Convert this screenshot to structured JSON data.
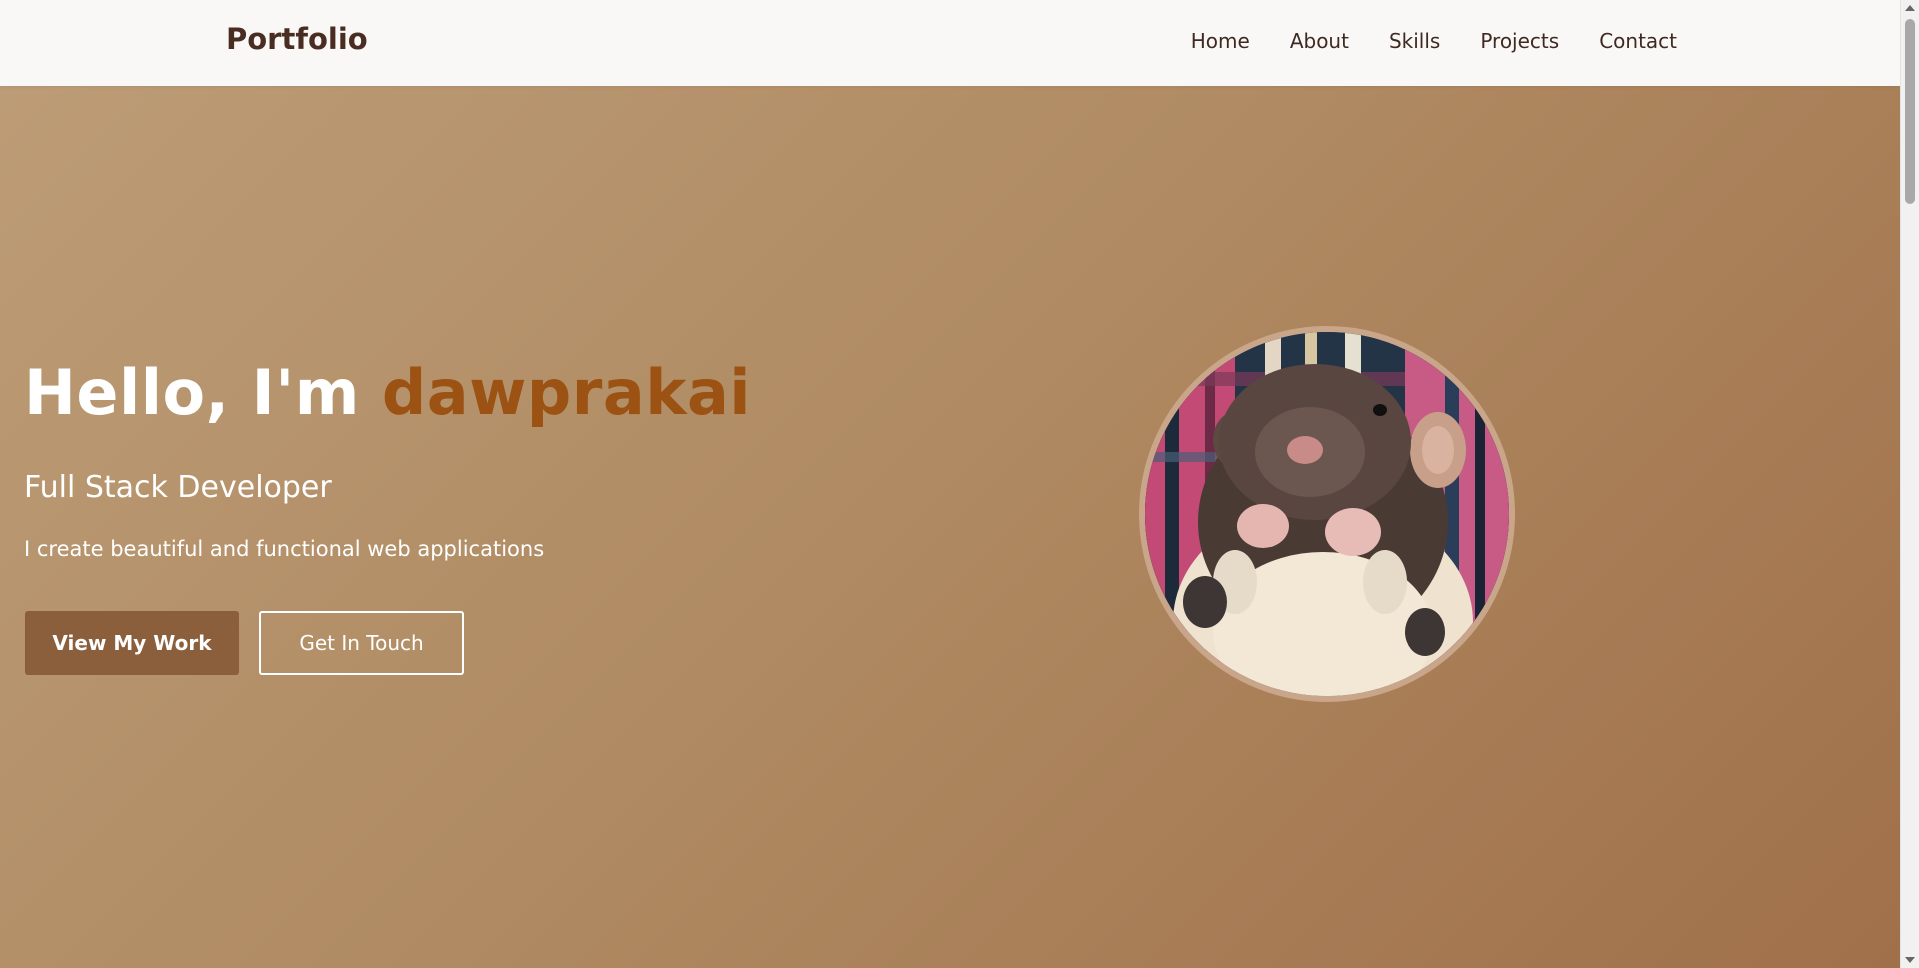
{
  "navbar": {
    "brand": "Portfolio",
    "links": [
      {
        "label": "Home"
      },
      {
        "label": "About"
      },
      {
        "label": "Skills"
      },
      {
        "label": "Projects"
      },
      {
        "label": "Contact"
      }
    ]
  },
  "hero": {
    "greeting_prefix": "Hello, I'm ",
    "name": "dawprakai",
    "role": "Full Stack Developer",
    "tagline": "I create beautiful and functional web applications",
    "primary_button": "View My Work",
    "secondary_button": "Get In Touch",
    "avatar_icon": "rat-photo"
  },
  "colors": {
    "brand_text": "#4a2d22",
    "name_accent": "#9b5212",
    "primary_button_bg": "#8b5e3c",
    "hero_gradient_start": "#bc9c76",
    "hero_gradient_end": "#a0704a"
  }
}
